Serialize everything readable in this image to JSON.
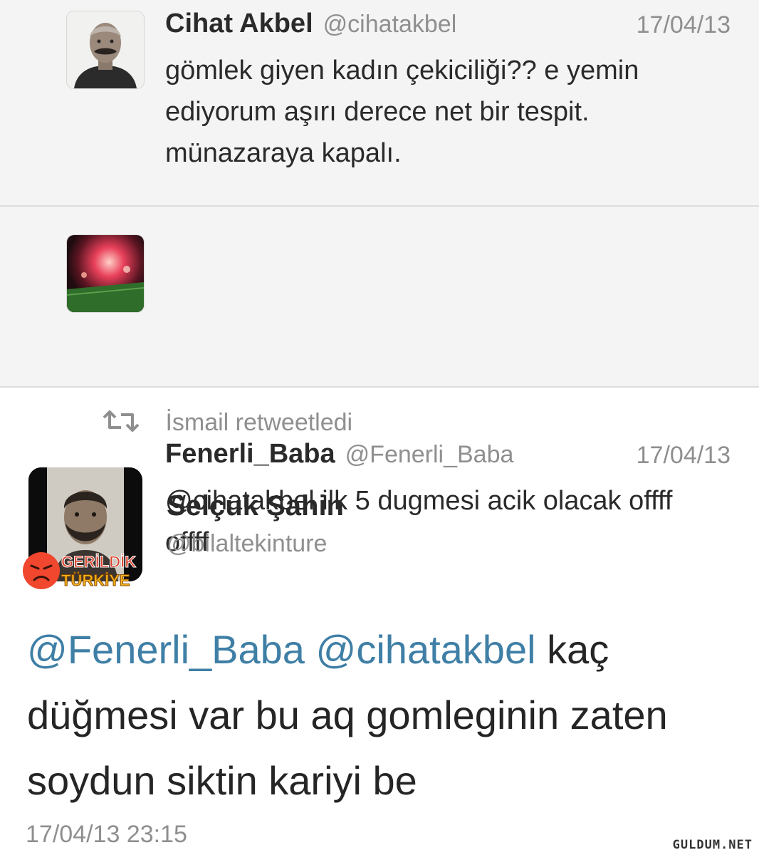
{
  "thread": [
    {
      "display_name": "Cihat Akbel",
      "handle": "@cihatakbel",
      "date": "17/04/13",
      "text": "gömlek giyen kadın çekiciliği?? e yemin ediyorum aşırı derece net bir tespit. münazaraya kapalı.",
      "avatar_icon": "profile-photo-mustached-man"
    },
    {
      "display_name": "Fenerli_Baba",
      "handle": "@Fenerli_Baba",
      "date": "17/04/13",
      "text": "@cihatakbel ilk 5 dugmesi acik olacak offff offff",
      "avatar_icon": "profile-photo-stadium-flares"
    }
  ],
  "retweet": {
    "label": "İsmail retweetledi",
    "icon": "retweet-icon"
  },
  "main_tweet": {
    "display_name": "Selçuk Şahin",
    "handle": "@bilaltekinture",
    "mentions": [
      "@Fenerli_Baba",
      "@cihatakbel"
    ],
    "text": "kaç düğmesi var bu aq gomleginin zaten soydun siktin kariyi be",
    "timestamp": "17/04/13 23:15",
    "avatar_icon": "profile-photo-bearded-man",
    "overlay_logo_text": "GERİLDİK TÜRKİYE"
  },
  "watermark": "GULDUM.NET",
  "colors": {
    "background": "#ffffff",
    "thread_background": "#f4f4f4",
    "divider": "#dcdcdc",
    "muted_text": "#8f8f8f",
    "body_text": "#2a2a2a",
    "mention": "#3f7fa6",
    "logo_red": "#d9402b",
    "logo_yellow": "#f7b51c"
  }
}
